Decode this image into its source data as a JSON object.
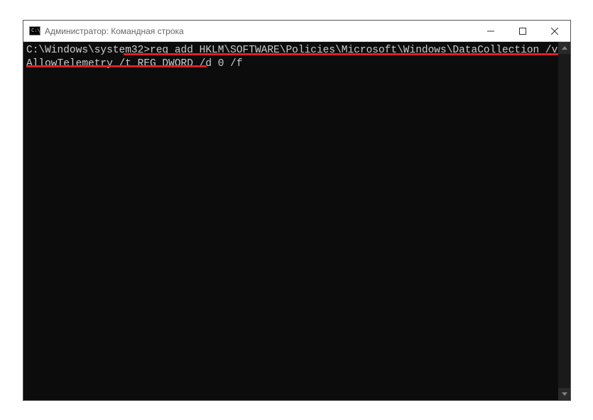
{
  "window": {
    "title": "Администратор: Командная строка",
    "icon_text": "C:\\."
  },
  "terminal": {
    "prompt": "C:\\Windows\\system32>",
    "command": "reg add HKLM\\SOFTWARE\\Policies\\Microsoft\\Windows\\DataCollection /v AllowTelemetry /t REG_DWORD /d 0 /f"
  }
}
